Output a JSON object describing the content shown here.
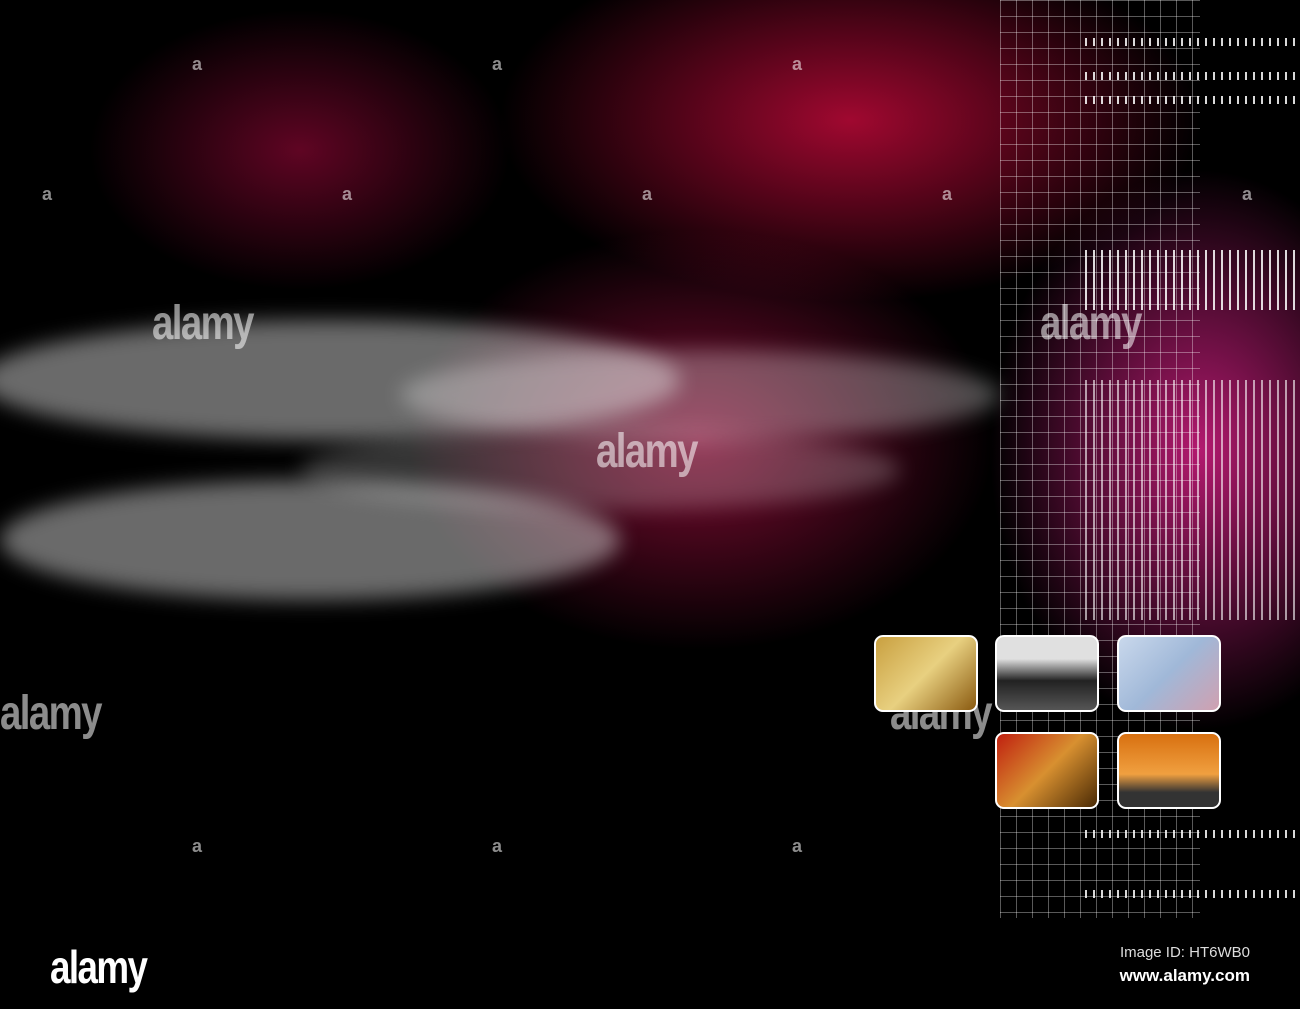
{
  "image": {
    "description_icon": "abstract-red-magenta-smoke-background"
  },
  "watermark": {
    "text": "alamy",
    "repeat_letter": "a"
  },
  "thumbnails": [
    {
      "name": "stamps-photo"
    },
    {
      "name": "businessman-on-phone-photo"
    },
    {
      "name": "net-text-photo"
    },
    {
      "name": "phone-keypad-photo"
    },
    {
      "name": "hands-typing-laptop-photo"
    }
  ],
  "footer": {
    "logo": "alamy",
    "image_id": "Image ID: HT6WB0",
    "website": "www.alamy.com"
  },
  "colors": {
    "accent": "#d0105a",
    "magenta": "#c81e8a"
  }
}
